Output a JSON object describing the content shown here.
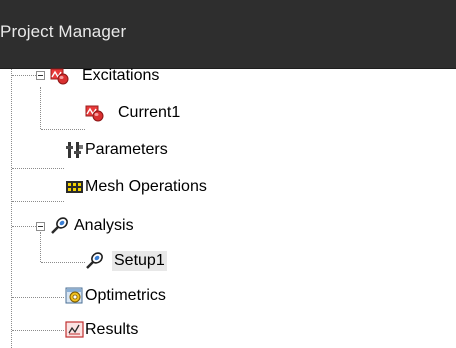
{
  "panel": {
    "title": "Project Manager"
  },
  "tree": {
    "items": [
      {
        "label": "Excitations",
        "icon": "excitations-icon",
        "expanded": true
      },
      {
        "label": "Current1",
        "icon": "current-excitation-icon"
      },
      {
        "label": "Parameters",
        "icon": "parameters-icon"
      },
      {
        "label": "Mesh Operations",
        "icon": "mesh-operations-icon"
      },
      {
        "label": "Analysis",
        "icon": "analysis-icon",
        "expanded": true
      },
      {
        "label": "Setup1",
        "icon": "setup-icon",
        "selected": true
      },
      {
        "label": "Optimetrics",
        "icon": "optimetrics-icon"
      },
      {
        "label": "Results",
        "icon": "results-icon"
      }
    ]
  },
  "colors": {
    "header_bg": "#2e2e2e",
    "header_text": "#e9e9e9",
    "tree_line": "#8c8c8c",
    "selection_bg": "#e8e8e8"
  }
}
